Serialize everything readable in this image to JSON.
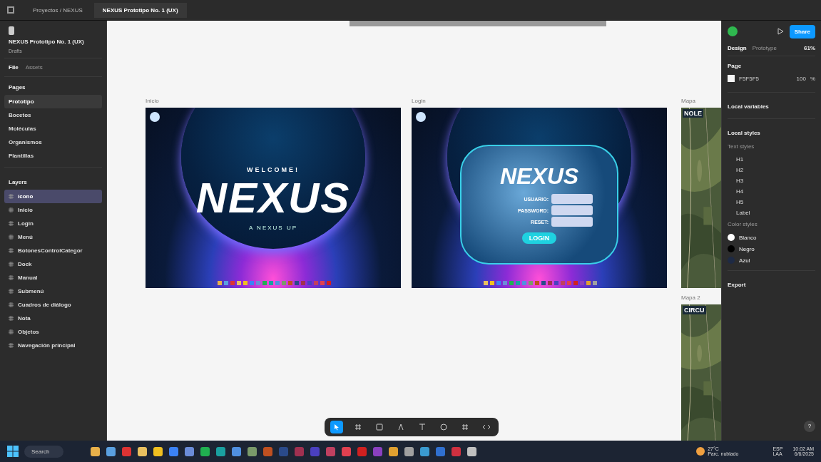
{
  "title_bar": {
    "tabs": [
      {
        "label": "Proyectos / NEXUS",
        "selected": false
      },
      {
        "label": "NEXUS Prototipo No. 1 (UX)",
        "selected": true
      }
    ]
  },
  "left_panel": {
    "file_name": "NEXUS Prototipo No. 1 (UX)",
    "location": "Drafts",
    "tabs": [
      {
        "label": "File",
        "selected": true
      },
      {
        "label": "Assets",
        "selected": false
      }
    ],
    "pages_title": "Pages",
    "pages": [
      {
        "label": "Prototipo",
        "selected": true
      },
      {
        "label": "Bocetos",
        "selected": false
      },
      {
        "label": "Moléculas",
        "selected": false
      },
      {
        "label": "Organismos",
        "selected": false
      },
      {
        "label": "Plantillas",
        "selected": false
      }
    ],
    "layers_title": "Layers",
    "layers": [
      {
        "label": "ícono",
        "selected": true
      },
      {
        "label": "Inicio",
        "selected": false
      },
      {
        "label": "Login",
        "selected": false
      },
      {
        "label": "Menú",
        "selected": false
      },
      {
        "label": "BotonesControlCategor",
        "selected": false
      },
      {
        "label": "Dock",
        "selected": false
      },
      {
        "label": "Manual",
        "selected": false
      },
      {
        "label": "Submenú",
        "selected": false
      },
      {
        "label": "Cuadros de diálogo",
        "selected": false
      },
      {
        "label": "Nota",
        "selected": false
      },
      {
        "label": "Objetos",
        "selected": false
      },
      {
        "label": "Navegación principal",
        "selected": false
      }
    ]
  },
  "canvas": {
    "frames": [
      {
        "kind": "welcome",
        "label": "Inicio",
        "welcome": "WELCOME!",
        "logo": "NEXUS",
        "tagline": "A NEXUS UP"
      },
      {
        "kind": "login",
        "label": "Login",
        "logo": "NEXUS",
        "fields": [
          "USUARIO:",
          "PASSWORD:",
          "RESET:"
        ],
        "button": "LOGIN"
      },
      {
        "kind": "map",
        "label": "Mapa",
        "heading": "NOLE"
      },
      {
        "kind": "map",
        "label": "Mapa 2",
        "heading": "CIRCU"
      }
    ]
  },
  "right_panel": {
    "share": "Share",
    "tabs": [
      {
        "label": "Design",
        "selected": true
      },
      {
        "label": "Prototype",
        "selected": false
      }
    ],
    "zoom": "61%",
    "page_title": "Page",
    "page_color": "F5F5F5",
    "page_opacity": "100",
    "page_percent": "%",
    "local_variables": "Local variables",
    "local_styles": "Local styles",
    "text_styles_title": "Text styles",
    "text_styles": [
      "H1",
      "H2",
      "H3",
      "H4",
      "H5",
      "Label"
    ],
    "color_styles_title": "Color styles",
    "color_styles": [
      {
        "name": "Blanco",
        "color": "#ffffff"
      },
      {
        "name": "Negro",
        "color": "#000000"
      },
      {
        "name": "Azul",
        "color": "#1e2a44"
      }
    ],
    "export": "Export",
    "help": "?"
  },
  "taskbar": {
    "search": "Search",
    "weather": "27°C",
    "weather_note": "Parc. nublado",
    "language": "ESP",
    "language_sub": "LAA",
    "time": "10:02 AM",
    "date": "6/6/2025"
  }
}
